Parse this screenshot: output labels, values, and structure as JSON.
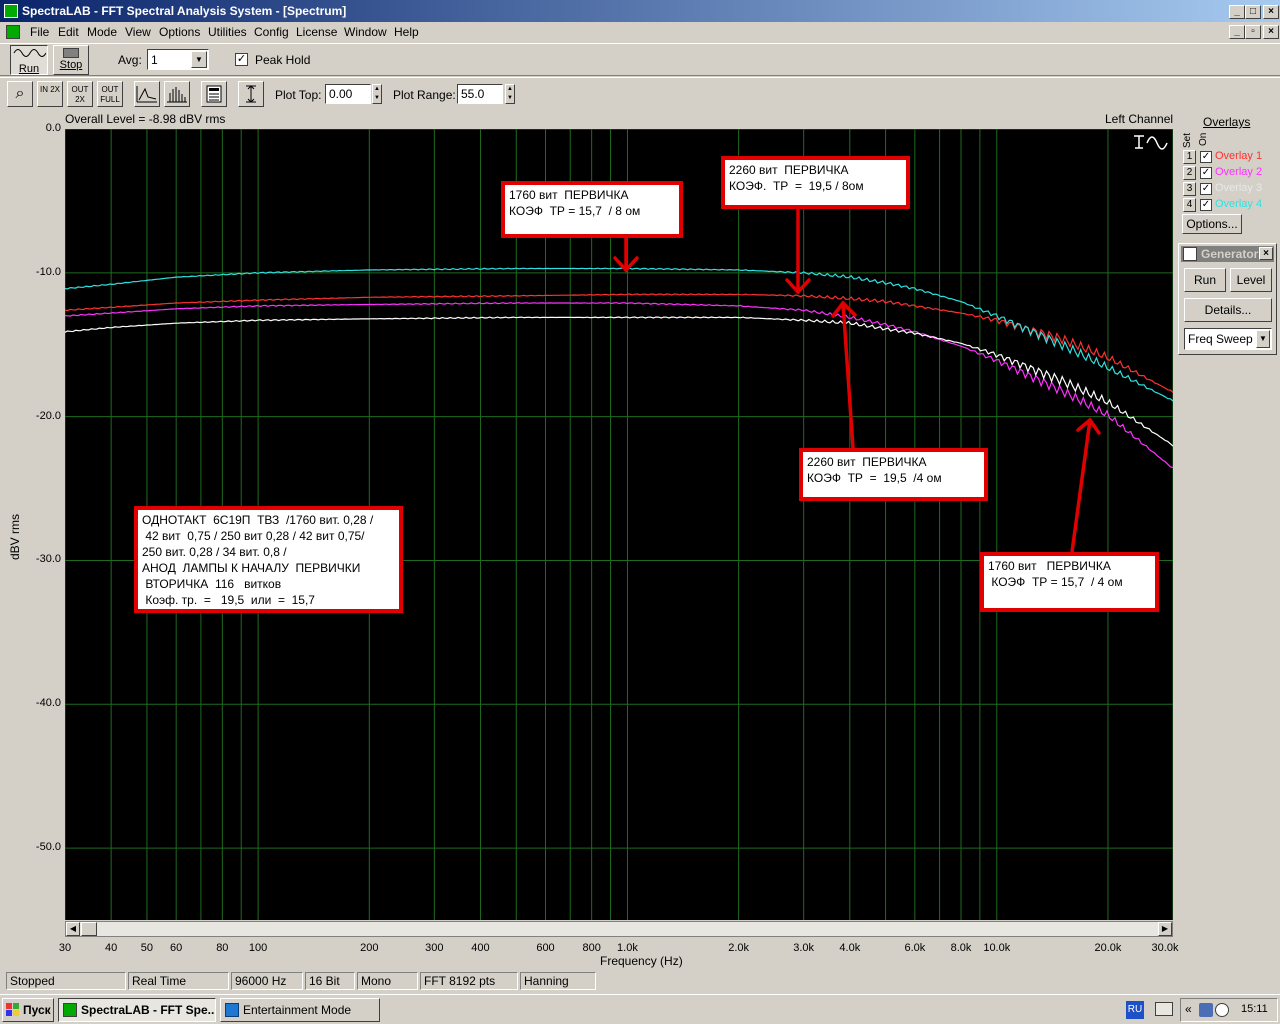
{
  "window": {
    "title": "SpectraLAB - FFT Spectral Analysis System - [Spectrum]"
  },
  "menu": [
    "File",
    "Edit",
    "Mode",
    "View",
    "Options",
    "Utilities",
    "Config",
    "License",
    "Window",
    "Help"
  ],
  "toolbar1": {
    "run_label": "Run",
    "stop_label": "Stop",
    "avg_label": "Avg:",
    "avg_value": "1",
    "peak_hold_label": "Peak Hold",
    "peak_hold_checked": true
  },
  "toolbar2": {
    "zoom_in_2x": "IN 2X",
    "zoom_out_2x": "OUT 2X",
    "zoom_out_full": "OUT FULL",
    "plot_top_label": "Plot Top:",
    "plot_top_value": "0.00",
    "plot_range_label": "Plot Range:",
    "plot_range_value": "55.0"
  },
  "plot_header": {
    "overall_level": "Overall Level = -8.98 dBV rms",
    "channel": "Left Channel"
  },
  "chart_data": {
    "type": "line",
    "xlabel": "Frequency (Hz)",
    "ylabel": "dBV rms",
    "xscale": "log",
    "xlim": [
      30,
      30000
    ],
    "ylim": [
      -55,
      0
    ],
    "grid": true,
    "y_ticks": [
      "0.0",
      "-10.0",
      "-20.0",
      "-30.0",
      "-40.0",
      "-50.0"
    ],
    "y_tick_values": [
      0,
      -10,
      -20,
      -30,
      -40,
      -50
    ],
    "x_ticks": [
      "30",
      "40",
      "50",
      "60",
      "80",
      "100",
      "200",
      "300",
      "400",
      "600",
      "800",
      "1.0k",
      "2.0k",
      "3.0k",
      "4.0k",
      "6.0k",
      "8.0k",
      "10.0k",
      "20.0k",
      "30.0k"
    ],
    "x_tick_values": [
      30,
      40,
      50,
      60,
      80,
      100,
      200,
      300,
      400,
      600,
      800,
      1000,
      2000,
      3000,
      4000,
      6000,
      8000,
      10000,
      20000,
      30000
    ],
    "series": [
      {
        "name": "Overlay 1",
        "color": "#ff3030",
        "x": [
          30,
          40,
          60,
          100,
          200,
          500,
          1000,
          2000,
          3000,
          4000,
          5000,
          6000,
          8000,
          10000,
          15000,
          20000,
          30000
        ],
        "y": [
          -12.6,
          -12.4,
          -12.1,
          -11.9,
          -11.7,
          -11.6,
          -11.5,
          -11.5,
          -11.6,
          -11.8,
          -12.0,
          -12.3,
          -12.8,
          -13.3,
          -14.6,
          -15.9,
          -18.3
        ]
      },
      {
        "name": "Overlay 2",
        "color": "#ff30ff",
        "x": [
          30,
          40,
          60,
          100,
          200,
          500,
          1000,
          2000,
          3000,
          4000,
          5000,
          6000,
          8000,
          10000,
          15000,
          20000,
          30000
        ],
        "y": [
          -13.0,
          -12.8,
          -12.5,
          -12.3,
          -12.2,
          -12.1,
          -12.1,
          -12.3,
          -12.6,
          -13.1,
          -13.6,
          -14.1,
          -15.1,
          -16.1,
          -18.2,
          -19.9,
          -23.6
        ]
      },
      {
        "name": "Overlay 3",
        "color": "#ffffff",
        "x": [
          30,
          40,
          60,
          100,
          200,
          500,
          1000,
          2000,
          3000,
          4000,
          5000,
          6000,
          8000,
          10000,
          15000,
          20000,
          30000
        ],
        "y": [
          -14.1,
          -13.8,
          -13.5,
          -13.3,
          -13.2,
          -13.1,
          -13.1,
          -13.1,
          -13.3,
          -13.5,
          -13.9,
          -14.2,
          -14.9,
          -15.7,
          -17.5,
          -19.0,
          -22.0
        ]
      },
      {
        "name": "Overlay 4",
        "color": "#30e0e0",
        "x": [
          30,
          40,
          60,
          100,
          200,
          500,
          1000,
          2000,
          3000,
          4000,
          5000,
          6000,
          8000,
          10000,
          15000,
          20000,
          30000
        ],
        "y": [
          -11.1,
          -10.8,
          -10.3,
          -10.0,
          -9.8,
          -9.7,
          -9.7,
          -9.8,
          -10.0,
          -10.3,
          -10.7,
          -11.1,
          -12.0,
          -13.0,
          -15.0,
          -16.6,
          -18.9
        ]
      }
    ]
  },
  "annotations": [
    {
      "text": "1760 вит  ПЕРВИЧКА\nКОЭФ  ТР = 15,7  / 8 ом"
    },
    {
      "text": "2260 вит  ПЕРВИЧКА\nКОЭФ.  ТР  =  19,5 / 8ом"
    },
    {
      "text": "2260 вит  ПЕРВИЧКА\nКОЭФ  ТР  =  19,5  /4 ом"
    },
    {
      "text": "1760 вит   ПЕРВИЧКА\n КОЭФ  ТР = 15,7  / 4 ом"
    },
    {
      "text": "ОДНОТАКТ  6С19П  ТВЗ  /1760 вит. 0,28 /\n 42 вит  0,75 / 250 вит 0,28 / 42 вит 0,75/\n250 вит. 0,28 / 34 вит. 0,8 /\nАНОД  ЛАМПЫ К НАЧАЛУ  ПЕРВИЧКИ\n ВТОРИЧКА  116   витков\n Коэф. тр.  =   19,5  или  =  15,7"
    }
  ],
  "overlays": {
    "title": "Overlays",
    "set_label": "Set",
    "on_label": "On",
    "items": [
      {
        "num": "1",
        "label": "Overlay 1",
        "color": "#ff3030",
        "checked": true
      },
      {
        "num": "2",
        "label": "Overlay 2",
        "color": "#ff30ff",
        "checked": true
      },
      {
        "num": "3",
        "label": "Overlay 3",
        "color": "#e8e8e8",
        "checked": true
      },
      {
        "num": "4",
        "label": "Overlay 4",
        "color": "#30e0e0",
        "checked": true
      }
    ],
    "options_label": "Options..."
  },
  "generator": {
    "title": "Generator",
    "run_label": "Run",
    "level_label": "Level",
    "details_label": "Details...",
    "mode_value": "Freq Sweep"
  },
  "status": [
    "Stopped",
    "Real Time",
    "96000 Hz",
    "16 Bit",
    "Mono",
    "FFT 8192 pts",
    "Hanning"
  ],
  "taskbar": {
    "start_label": "Пуск",
    "tasks": [
      "SpectraLAB - FFT Spe...",
      "Entertainment Mode"
    ],
    "lang": "RU",
    "clock": "15:11"
  }
}
